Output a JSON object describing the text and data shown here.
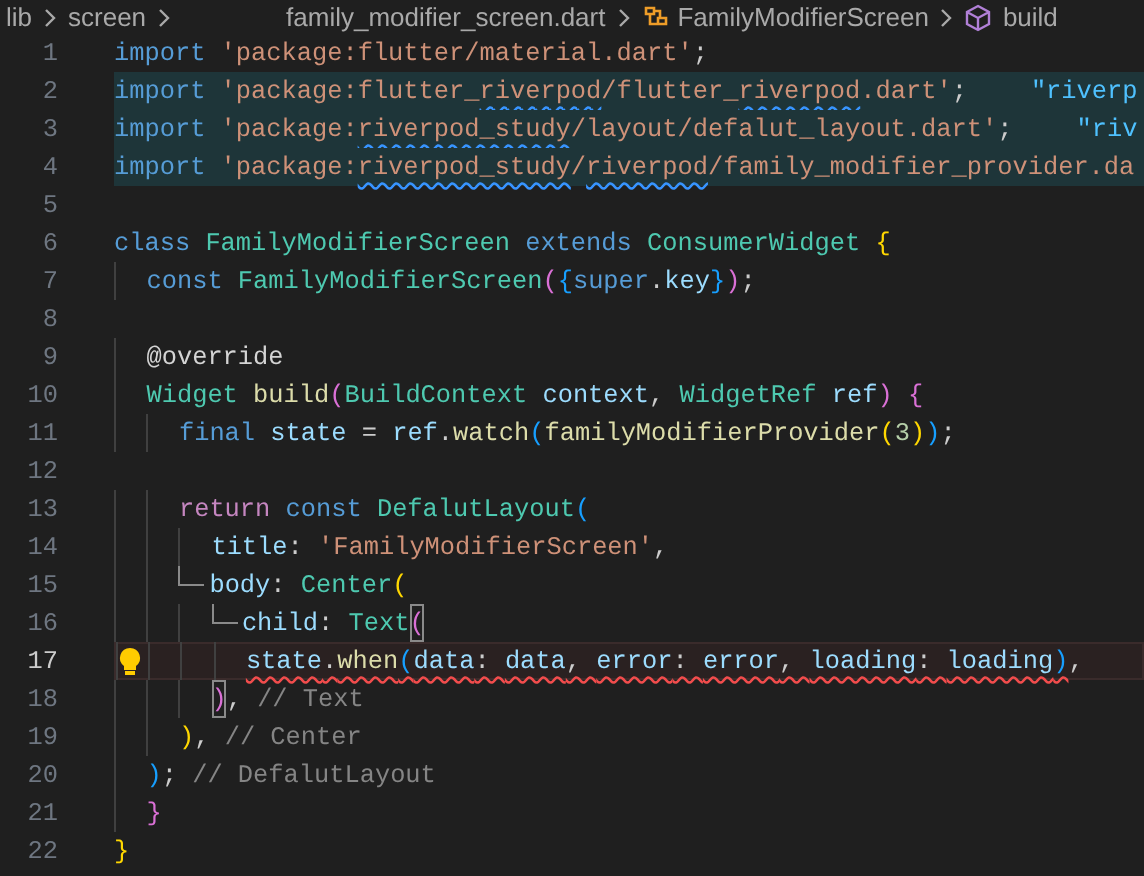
{
  "breadcrumb": [
    {
      "text": "lib",
      "kind": "folder"
    },
    {
      "text": "screen",
      "kind": "folder"
    },
    {
      "text": "family_modifier_screen.dart",
      "kind": "file"
    },
    {
      "text": "FamilyModifierScreen",
      "kind": "class"
    },
    {
      "text": "build",
      "kind": "method"
    }
  ],
  "editor": {
    "lines": [
      {
        "number": "1",
        "active": false,
        "selected": false,
        "tokens": [
          {
            "text": "import",
            "kind": "kw"
          },
          {
            "text": " 'package:flutter/material.dart'",
            "kind": "str"
          },
          {
            "text": ";",
            "kind": "punct"
          }
        ]
      },
      {
        "number": "2",
        "active": false,
        "selected": true,
        "hint": "\"riverp",
        "tokens": [
          {
            "text": "import",
            "kind": "kw"
          },
          {
            "text": " 'package:flutter_",
            "kind": "str"
          },
          {
            "text": "riverpod",
            "kind": "str",
            "warning": true
          },
          {
            "text": "/flutter_",
            "kind": "str"
          },
          {
            "text": "riverpod",
            "kind": "str",
            "warning": true
          },
          {
            "text": ".dart'",
            "kind": "str"
          },
          {
            "text": ";",
            "kind": "punct"
          }
        ]
      },
      {
        "number": "3",
        "active": false,
        "selected": true,
        "hint": "\"riv",
        "tokens": [
          {
            "text": "import",
            "kind": "kw"
          },
          {
            "text": " 'package:",
            "kind": "str"
          },
          {
            "text": "riverpod_study",
            "kind": "str",
            "warning": true
          },
          {
            "text": "/layout/defalut_layout.dart'",
            "kind": "str"
          },
          {
            "text": ";",
            "kind": "punct"
          }
        ]
      },
      {
        "number": "4",
        "active": false,
        "selected": true,
        "tokens": [
          {
            "text": "import",
            "kind": "kw"
          },
          {
            "text": " 'package:",
            "kind": "str"
          },
          {
            "text": "riverpod_study",
            "kind": "str",
            "warning": true
          },
          {
            "text": "/",
            "kind": "str"
          },
          {
            "text": "riverpod",
            "kind": "str",
            "warning": true
          },
          {
            "text": "/family_modifier_provider.da",
            "kind": "str"
          }
        ]
      },
      {
        "number": "5",
        "active": false,
        "selected": false
      },
      {
        "number": "6",
        "active": false,
        "selected": false,
        "tokens": [
          {
            "text": "class ",
            "kind": "kw"
          },
          {
            "text": "FamilyModifierScreen ",
            "kind": "type"
          },
          {
            "text": "extends ",
            "kind": "kw"
          },
          {
            "text": "ConsumerWidget ",
            "kind": "type"
          },
          {
            "text": "{",
            "kind": "b1"
          }
        ]
      },
      {
        "number": "7",
        "active": false,
        "selected": false,
        "tokens": [
          {
            "text": "  const ",
            "kind": "kw"
          },
          {
            "text": "FamilyModifierScreen",
            "kind": "type"
          },
          {
            "text": "(",
            "kind": "b2"
          },
          {
            "text": "{",
            "kind": "b3"
          },
          {
            "text": "super",
            "kind": "kw"
          },
          {
            "text": ".",
            "kind": "punct"
          },
          {
            "text": "key",
            "kind": "var"
          },
          {
            "text": "}",
            "kind": "b3"
          },
          {
            "text": ")",
            "kind": "b2"
          },
          {
            "text": ";",
            "kind": "punct"
          }
        ]
      },
      {
        "number": "8",
        "active": false,
        "selected": false
      },
      {
        "number": "9",
        "active": false,
        "selected": false,
        "tokens": [
          {
            "text": "  @override",
            "kind": "ann"
          }
        ]
      },
      {
        "number": "10",
        "active": false,
        "selected": false,
        "tokens": [
          {
            "text": "  Widget ",
            "kind": "type"
          },
          {
            "text": "build",
            "kind": "fn"
          },
          {
            "text": "(",
            "kind": "b2"
          },
          {
            "text": "BuildContext ",
            "kind": "type"
          },
          {
            "text": "context",
            "kind": "var"
          },
          {
            "text": ", ",
            "kind": "punct"
          },
          {
            "text": "WidgetRef ",
            "kind": "type"
          },
          {
            "text": "ref",
            "kind": "var"
          },
          {
            "text": ") ",
            "kind": "b2"
          },
          {
            "text": "{",
            "kind": "b2"
          }
        ]
      },
      {
        "number": "11",
        "active": false,
        "selected": false,
        "tokens": [
          {
            "text": "    final ",
            "kind": "kw"
          },
          {
            "text": "state",
            "kind": "var"
          },
          {
            "text": " = ",
            "kind": "punct"
          },
          {
            "text": "ref",
            "kind": "var"
          },
          {
            "text": ".",
            "kind": "punct"
          },
          {
            "text": "watch",
            "kind": "fn"
          },
          {
            "text": "(",
            "kind": "b3"
          },
          {
            "text": "familyModifierProvider",
            "kind": "fn"
          },
          {
            "text": "(",
            "kind": "b1"
          },
          {
            "text": "3",
            "kind": "num"
          },
          {
            "text": ")",
            "kind": "b1"
          },
          {
            "text": ")",
            "kind": "b3"
          },
          {
            "text": ";",
            "kind": "punct"
          }
        ]
      },
      {
        "number": "12",
        "active": false,
        "selected": false
      },
      {
        "number": "13",
        "active": false,
        "selected": false,
        "tokens": [
          {
            "text": "    return ",
            "kind": "ctrl"
          },
          {
            "text": "const ",
            "kind": "kw"
          },
          {
            "text": "DefalutLayout",
            "kind": "type"
          },
          {
            "text": "(",
            "kind": "b3"
          }
        ]
      },
      {
        "number": "14",
        "active": false,
        "selected": false,
        "tokens": [
          {
            "text": "      title",
            "kind": "var"
          },
          {
            "text": ": ",
            "kind": "punct"
          },
          {
            "text": "'FamilyModifierScreen'",
            "kind": "str"
          },
          {
            "text": ",",
            "kind": "punct"
          }
        ]
      },
      {
        "number": "15",
        "active": false,
        "selected": false,
        "branch": true,
        "tokens": [
          {
            "text": "      body",
            "kind": "var"
          },
          {
            "text": ": ",
            "kind": "punct"
          },
          {
            "text": "Center",
            "kind": "type"
          },
          {
            "text": "(",
            "kind": "b1"
          }
        ]
      },
      {
        "number": "16",
        "active": false,
        "selected": false,
        "branch": true,
        "tokens": [
          {
            "text": "        child",
            "kind": "var"
          },
          {
            "text": ": ",
            "kind": "punct"
          },
          {
            "text": "Text",
            "kind": "type"
          },
          {
            "text": "(",
            "kind": "b2",
            "match": true
          }
        ]
      },
      {
        "number": "17",
        "active": true,
        "selected": false,
        "bulb": true,
        "tokens": [
          {
            "text": "        state",
            "kind": "var",
            "error": true
          },
          {
            "text": ".",
            "kind": "punct",
            "error": true
          },
          {
            "text": "when",
            "kind": "fn",
            "error": true
          },
          {
            "text": "(",
            "kind": "b3",
            "error": true
          },
          {
            "text": "data",
            "kind": "var",
            "error": true
          },
          {
            "text": ": ",
            "kind": "punct",
            "error": true
          },
          {
            "text": "data",
            "kind": "var",
            "error": true
          },
          {
            "text": ", ",
            "kind": "punct",
            "error": true
          },
          {
            "text": "error",
            "kind": "var",
            "error": true
          },
          {
            "text": ": ",
            "kind": "punct",
            "error": true
          },
          {
            "text": "error",
            "kind": "var",
            "error": true
          },
          {
            "text": ", ",
            "kind": "punct",
            "error": true
          },
          {
            "text": "loading",
            "kind": "var",
            "error": true
          },
          {
            "text": ": ",
            "kind": "punct",
            "error": true
          },
          {
            "text": "loading",
            "kind": "var",
            "error": true
          },
          {
            "text": ")",
            "kind": "b3",
            "error": true
          },
          {
            "text": ",",
            "kind": "punct"
          }
        ]
      },
      {
        "number": "18",
        "active": false,
        "selected": false,
        "tokens": [
          {
            "text": "      )",
            "kind": "b2",
            "match": true
          },
          {
            "text": ", ",
            "kind": "punct"
          },
          {
            "text": "// Text",
            "kind": "comment"
          }
        ]
      },
      {
        "number": "19",
        "active": false,
        "selected": false,
        "tokens": [
          {
            "text": "    )",
            "kind": "b1"
          },
          {
            "text": ", ",
            "kind": "punct"
          },
          {
            "text": "// Center",
            "kind": "comment"
          }
        ]
      },
      {
        "number": "20",
        "active": false,
        "selected": false,
        "tokens": [
          {
            "text": "  )",
            "kind": "b3"
          },
          {
            "text": "; ",
            "kind": "punct"
          },
          {
            "text": "// DefalutLayout",
            "kind": "comment"
          }
        ]
      },
      {
        "number": "21",
        "active": false,
        "selected": false,
        "tokens": [
          {
            "text": "  }",
            "kind": "b2"
          }
        ]
      },
      {
        "number": "22",
        "active": false,
        "selected": false,
        "tokens": [
          {
            "text": "}",
            "kind": "b1"
          }
        ]
      }
    ]
  }
}
